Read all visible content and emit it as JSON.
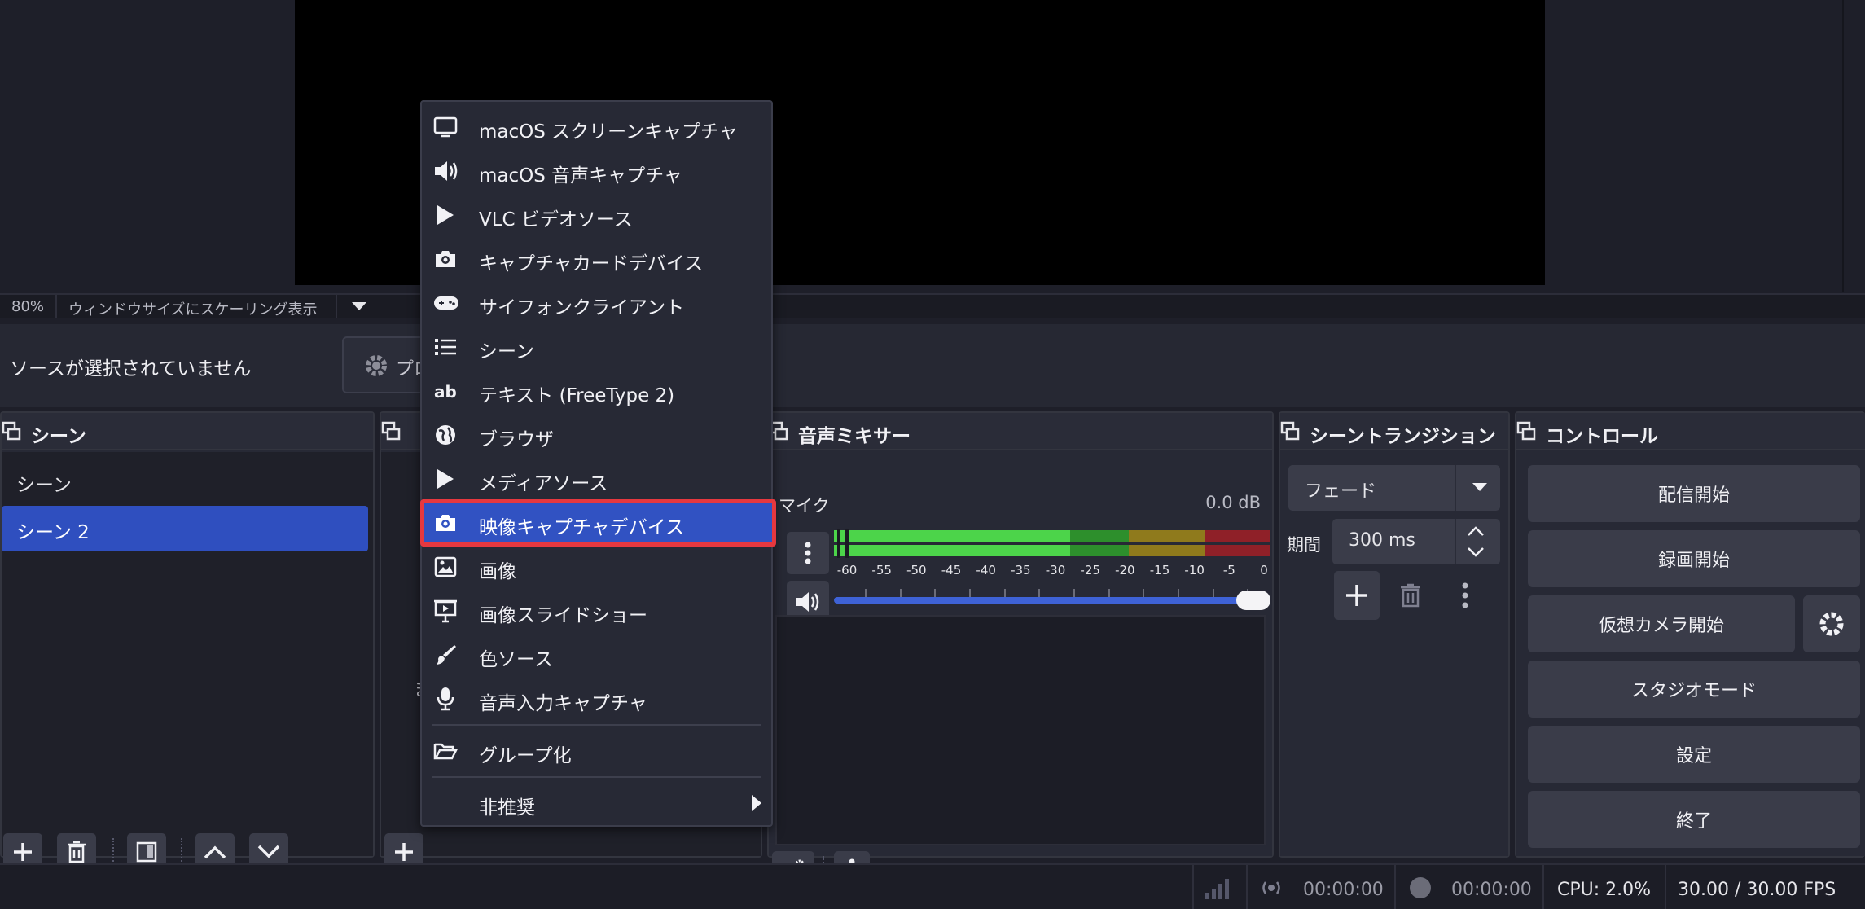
{
  "zoom_bar": {
    "zoom": "80%",
    "scale_mode": "ウィンドウサイズにスケーリング表示"
  },
  "context_bar": {
    "no_source": "ソースが選択されていません",
    "properties_label": "プロ"
  },
  "scenes": {
    "title": "シーン",
    "items": [
      "シーン",
      "シーン 2"
    ],
    "selected_index": 1
  },
  "sources": {
    "hidden_char": "ま"
  },
  "mixer": {
    "title": "音声ミキサー",
    "channel": {
      "name": "マイク",
      "db": "0.0 dB",
      "volume_fraction": 1.0
    },
    "ticks": [
      "-60",
      "-55",
      "-50",
      "-45",
      "-40",
      "-35",
      "-30",
      "-25",
      "-20",
      "-15",
      "-10",
      "-5",
      "0"
    ]
  },
  "transitions": {
    "title": "シーントランジション",
    "selected": "フェード",
    "duration_label": "期間",
    "duration_value": "300 ms"
  },
  "controls": {
    "title": "コントロール",
    "buttons": [
      "配信開始",
      "録画開始",
      "仮想カメラ開始",
      "スタジオモード",
      "設定",
      "終了"
    ]
  },
  "status_bar": {
    "stream_time": "00:00:00",
    "record_time": "00:00:00",
    "cpu": "CPU: 2.0%",
    "fps": "30.00 / 30.00 FPS"
  },
  "add_source_menu": {
    "items": [
      {
        "label": "macOS スクリーンキャプチャ",
        "icon": "monitor-icon"
      },
      {
        "label": "macOS 音声キャプチャ",
        "icon": "speaker-icon"
      },
      {
        "label": "VLC ビデオソース",
        "icon": "play-icon"
      },
      {
        "label": "キャプチャカードデバイス",
        "icon": "camera-icon"
      },
      {
        "label": "サイフォンクライアント",
        "icon": "gamepad-icon"
      },
      {
        "label": "シーン",
        "icon": "list-icon"
      },
      {
        "label": "テキスト (FreeType 2)",
        "icon": "text-icon"
      },
      {
        "label": "ブラウザ",
        "icon": "globe-icon"
      },
      {
        "label": "メディアソース",
        "icon": "play-icon"
      },
      {
        "label": "映像キャプチャデバイス",
        "icon": "camera-icon"
      },
      {
        "label": "画像",
        "icon": "image-icon"
      },
      {
        "label": "画像スライドショー",
        "icon": "slideshow-icon"
      },
      {
        "label": "色ソース",
        "icon": "brush-icon"
      },
      {
        "label": "音声入力キャプチャ",
        "icon": "microphone-icon"
      }
    ],
    "group_label": "グループ化",
    "deprecated_label": "非推奨",
    "highlighted_index": 9
  }
}
